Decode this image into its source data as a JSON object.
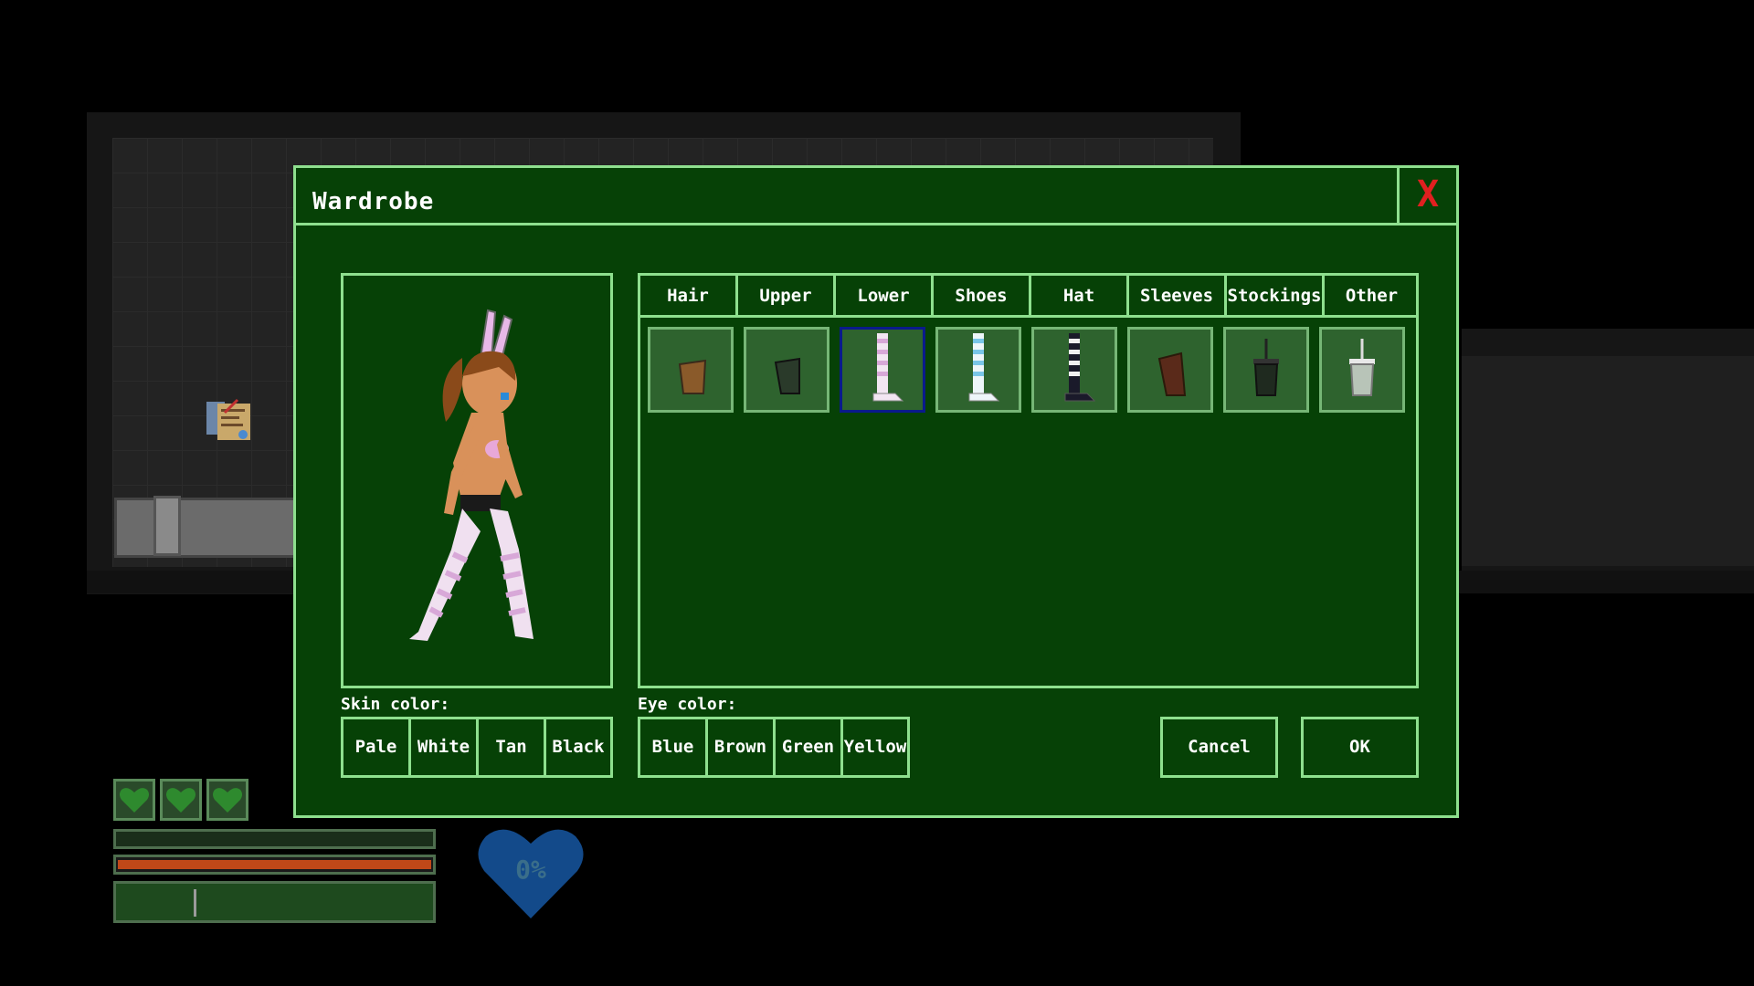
{
  "dialog": {
    "title": "Wardrobe",
    "close_glyph": "X"
  },
  "tabs": [
    {
      "label": "Hair"
    },
    {
      "label": "Upper"
    },
    {
      "label": "Lower"
    },
    {
      "label": "Shoes"
    },
    {
      "label": "Hat"
    },
    {
      "label": "Sleeves"
    },
    {
      "label": "Stockings"
    },
    {
      "label": "Other"
    }
  ],
  "items": [
    {
      "name": "brown-cup-item"
    },
    {
      "name": "dark-green-cup-item"
    },
    {
      "name": "pink-striped-stocking-item",
      "selected": true
    },
    {
      "name": "blue-striped-stocking-item"
    },
    {
      "name": "black-striped-stocking-item"
    },
    {
      "name": "brown-sleeve-item"
    },
    {
      "name": "dark-cup-straw-item"
    },
    {
      "name": "white-cup-straw-item"
    }
  ],
  "skin": {
    "label": "Skin color:",
    "options": [
      "Pale",
      "White",
      "Tan",
      "Black"
    ]
  },
  "eye": {
    "label": "Eye color:",
    "options": [
      "Blue",
      "Brown",
      "Green",
      "Yellow"
    ]
  },
  "buttons": {
    "cancel": "Cancel",
    "ok": "OK"
  },
  "hud": {
    "hearts": 3,
    "arousal_percent": "0%"
  },
  "colors": {
    "dialog_bg": "#064106",
    "border": "#8ee08e",
    "close": "#e02020",
    "selected_item_border": "#0a1a8c"
  }
}
